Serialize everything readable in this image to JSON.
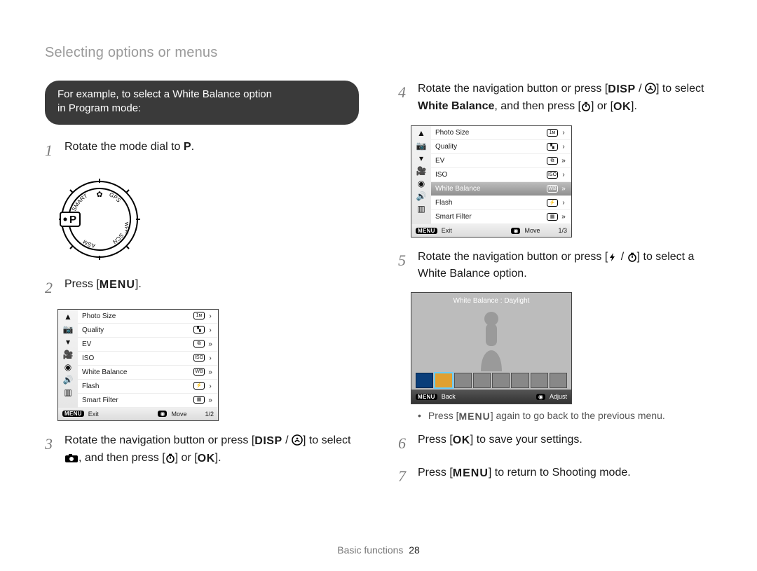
{
  "header": {
    "breadcrumb": "Selecting options or menus"
  },
  "pill": {
    "line1": "For example, to select a White Balance option",
    "line2": "in Program mode:"
  },
  "labels": {
    "menu": "MENU",
    "ok": "OK",
    "disp": "DISP"
  },
  "steps_left": {
    "s1": {
      "num": "1",
      "text_a": "Rotate the mode dial to ",
      "text_b": "."
    },
    "s2": {
      "num": "2",
      "text_a": "Press [",
      "text_b": "]."
    },
    "s3": {
      "num": "3",
      "text_a": "Rotate the navigation button or press [",
      "text_b": "] to select ",
      "text_c": ", and then press [",
      "text_d": "] or [",
      "text_e": "]."
    }
  },
  "steps_right": {
    "s4": {
      "num": "4",
      "text_a": "Rotate the navigation button or press [",
      "text_b": "] to select ",
      "wb": "White Balance",
      "text_c": ", and then press [",
      "text_d": "] or [",
      "text_e": "]."
    },
    "s5": {
      "num": "5",
      "text_a": "Rotate the navigation button or press [",
      "text_b": "] to select a White Balance option."
    },
    "note": {
      "bullet": "•",
      "a": "Press [",
      "b": "] again to go back to the previous menu."
    },
    "s6": {
      "num": "6",
      "a": "Press [",
      "b": "] to save your settings."
    },
    "s7": {
      "num": "7",
      "a": "Press [",
      "b": "] to return to Shooting mode."
    }
  },
  "menu_screen_a": {
    "side_icons": [
      "camera-icon",
      "camera-solid-icon",
      "video-icon",
      "sound-icon",
      "speaker-icon",
      "display-icon"
    ],
    "rows": [
      {
        "label": "Photo Size"
      },
      {
        "label": "Quality"
      },
      {
        "label": "EV"
      },
      {
        "label": "ISO"
      },
      {
        "label": "White Balance"
      },
      {
        "label": "Flash"
      },
      {
        "label": "Smart Filter"
      }
    ],
    "foot": {
      "exit": "Exit",
      "move": "Move",
      "page": "1/2"
    }
  },
  "menu_screen_b": {
    "side_icons": [
      "camera-icon",
      "camera-solid-icon",
      "video-icon",
      "sound-icon",
      "speaker-icon",
      "display-icon"
    ],
    "rows": [
      {
        "label": "Photo Size"
      },
      {
        "label": "Quality"
      },
      {
        "label": "EV"
      },
      {
        "label": "ISO"
      },
      {
        "label": "White Balance",
        "selected": true
      },
      {
        "label": "Flash"
      },
      {
        "label": "Smart Filter"
      }
    ],
    "foot": {
      "exit": "Exit",
      "move": "Move",
      "page": "1/3"
    }
  },
  "wb_screen": {
    "title": "White Balance : Daylight",
    "foot": {
      "back": "Back",
      "adjust": "Adjust"
    }
  },
  "mode_dial": {
    "labels": [
      "SMART",
      "GPS",
      "Wi-Fi",
      "SCN",
      "ASM",
      "P"
    ]
  },
  "footer": {
    "section": "Basic functions",
    "page": "28"
  }
}
